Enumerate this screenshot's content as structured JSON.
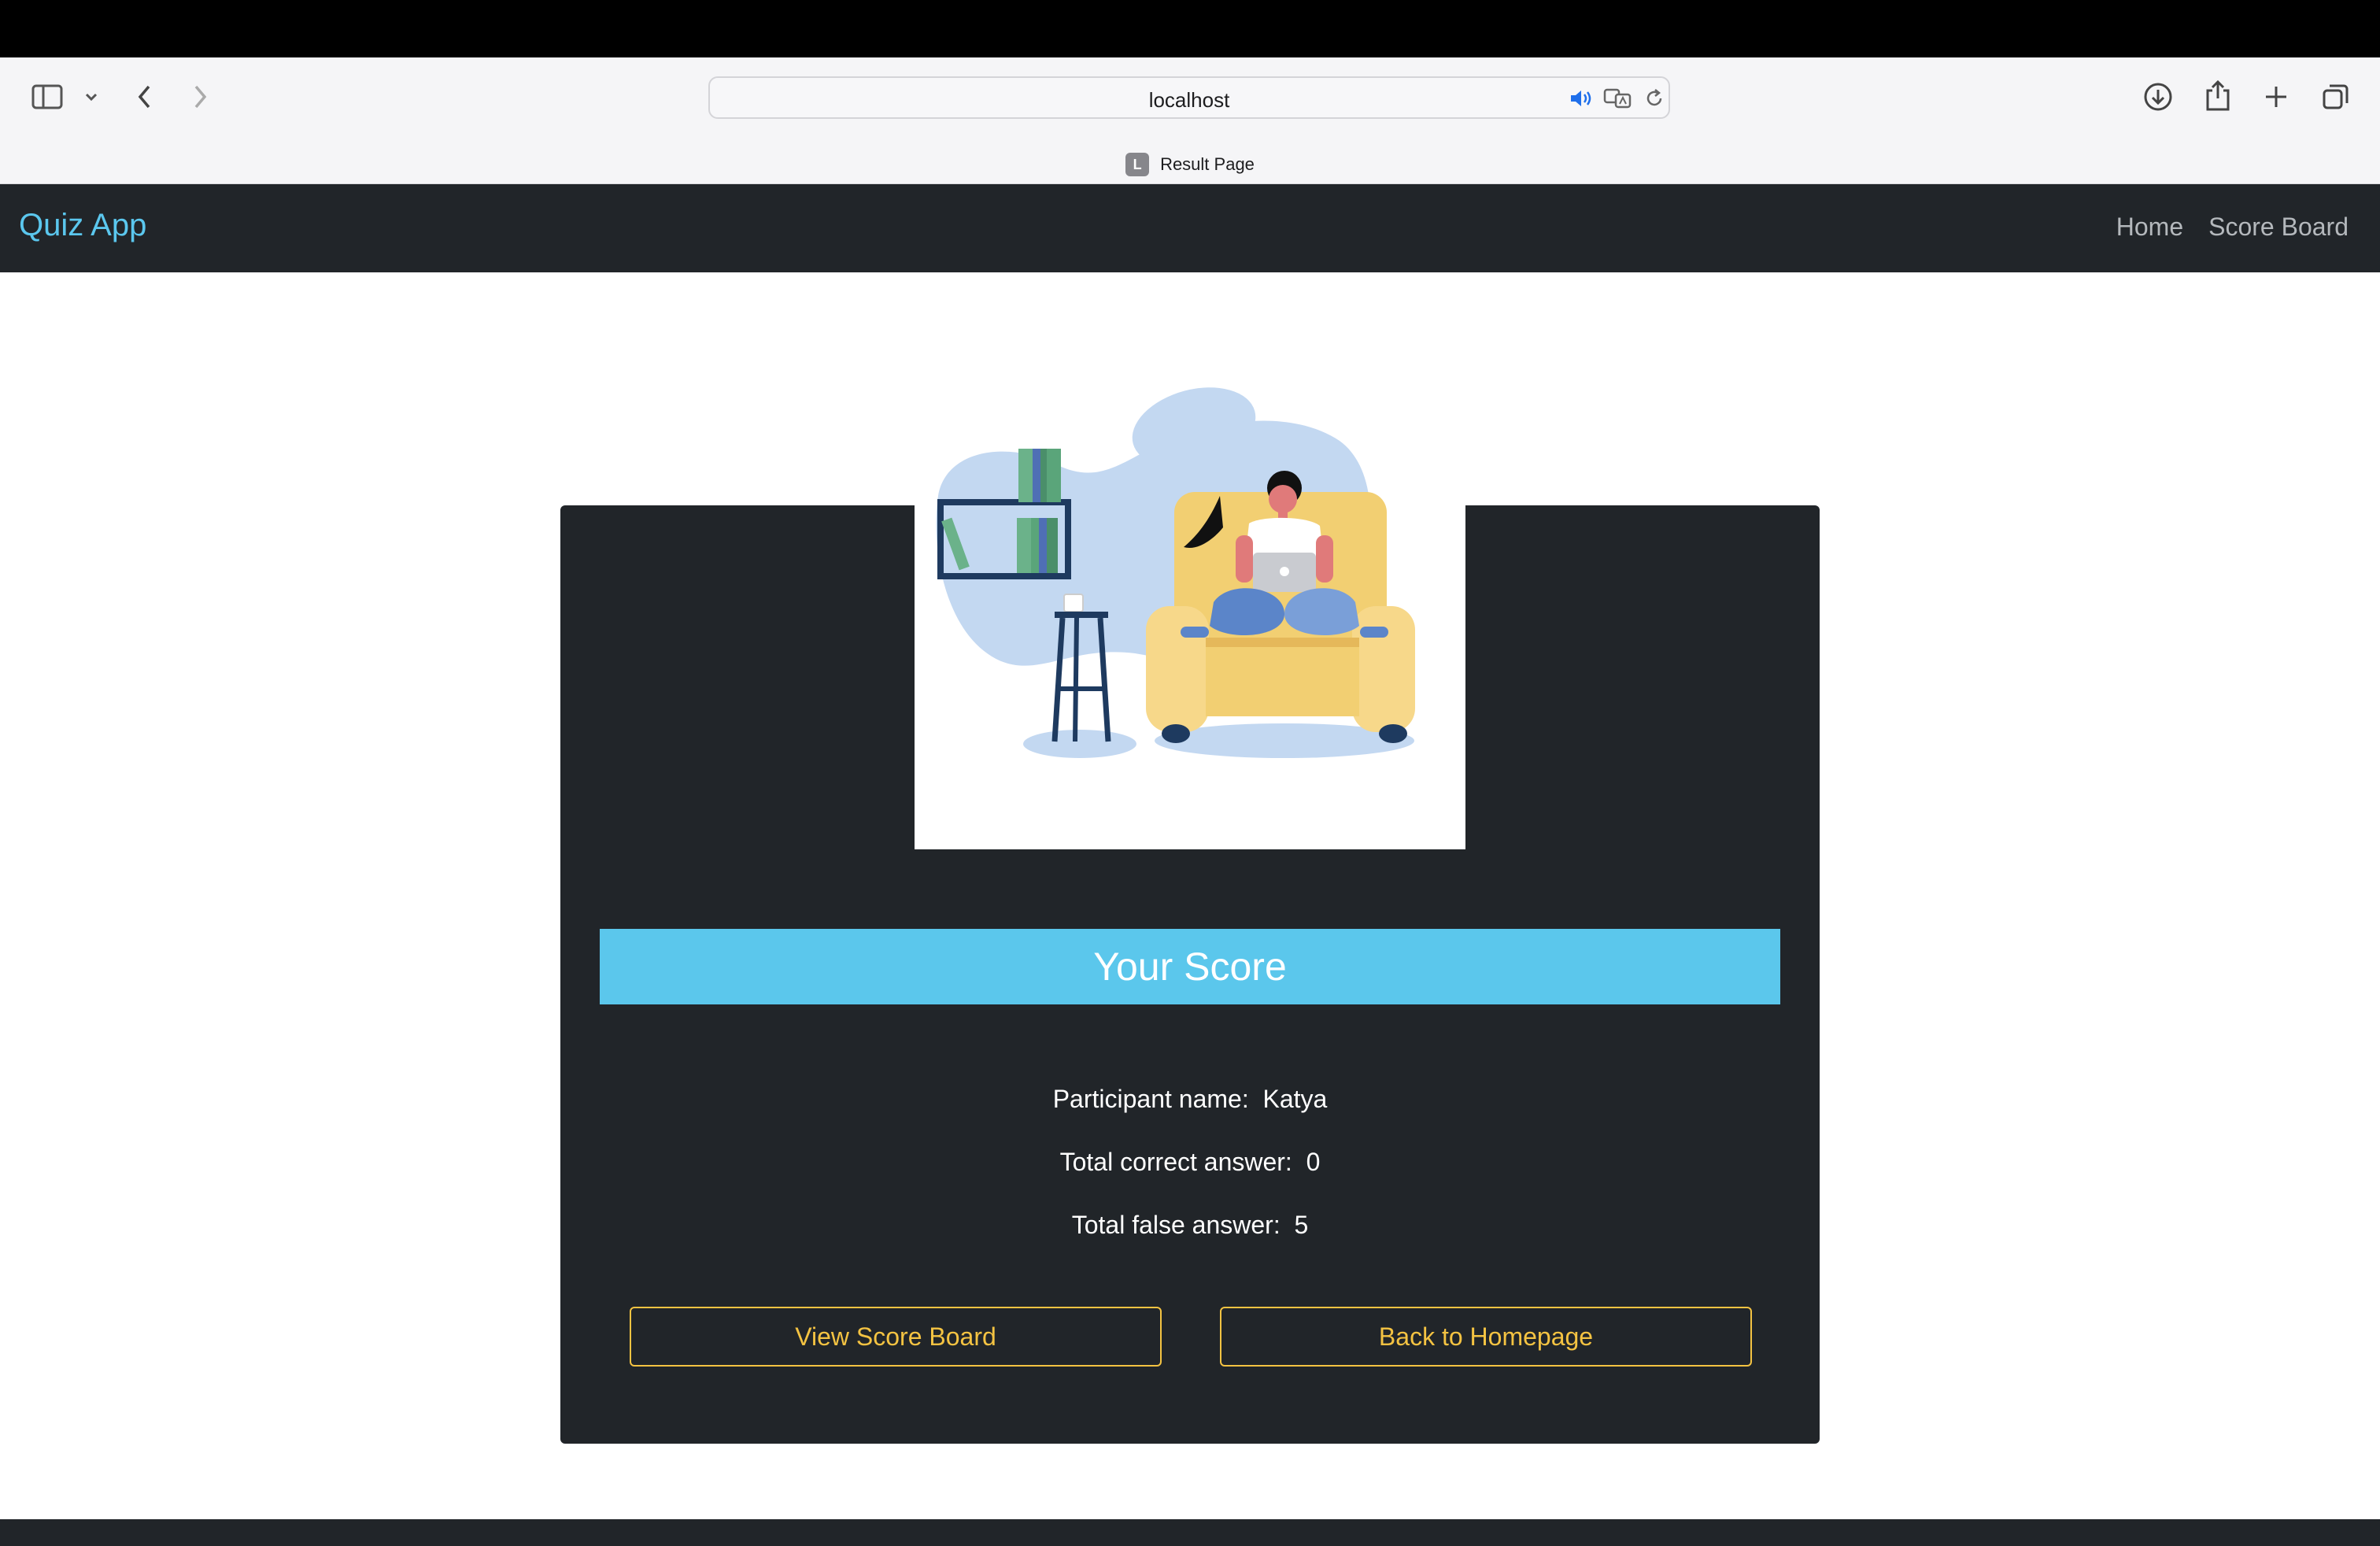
{
  "browser": {
    "url": "localhost",
    "tab": {
      "favicon_letter": "L",
      "title": "Result Page"
    }
  },
  "navbar": {
    "brand": "Quiz App",
    "links": [
      "Home",
      "Score Board"
    ]
  },
  "result": {
    "heading": "Your Score",
    "participant_label": "Participant name:",
    "participant_name": "Katya",
    "correct_label": "Total correct answer:",
    "correct_value": "0",
    "false_label": "Total false answer:",
    "false_value": "5"
  },
  "actions": {
    "view_score_board": "View Score Board",
    "back_home": "Back to Homepage"
  },
  "colors": {
    "accent": "#5bc7ec",
    "dark": "#212529",
    "button": "#f4c342"
  }
}
